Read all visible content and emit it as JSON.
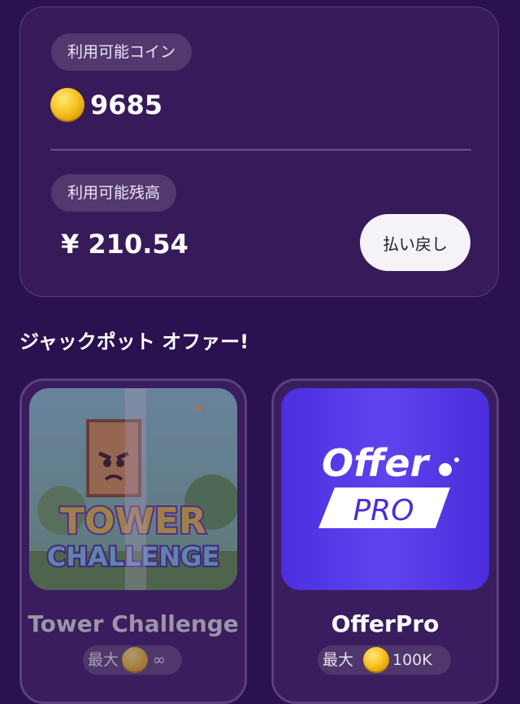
{
  "balance": {
    "coins_label": "利用可能コイン",
    "coins_value": "9685",
    "balance_label": "利用可能残高",
    "balance_value": "¥ 210.54",
    "refund_label": "払い戻し"
  },
  "jackpot": {
    "title": "ジャックポット オファー!",
    "offers": [
      {
        "name": "Tower Challenge",
        "logo_line1": "TOWER",
        "logo_line2": "CHALLENGE",
        "reward_prefix": "最大",
        "reward_value": "∞"
      },
      {
        "name": "OfferPro",
        "logo_word": "Offer",
        "logo_badge": "PRO",
        "reward_prefix": "最大",
        "reward_value": "100K"
      }
    ]
  },
  "colors": {
    "background": "#2a1150",
    "card": "#361a5a",
    "pill": "#53386f",
    "coin": "#f7c321",
    "offerpro_brand": "#5a3de8"
  }
}
